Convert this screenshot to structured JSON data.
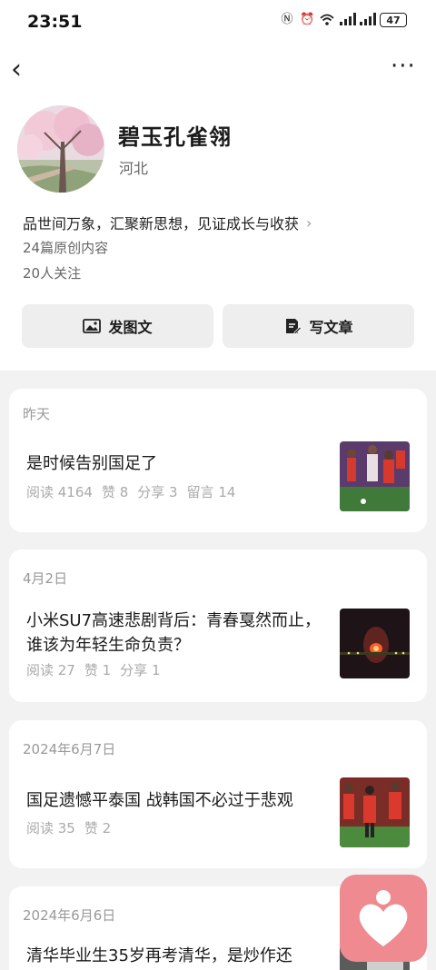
{
  "status": {
    "time": "23:51",
    "battery": "47",
    "icons": [
      "nfc-icon",
      "alarm-icon",
      "wifi-icon",
      "signal-icon",
      "signal-icon"
    ]
  },
  "nav": {
    "back_icon": "back-arrow-icon",
    "more_icon": "more-icon"
  },
  "profile": {
    "name": "碧玉孔雀翎",
    "region": "河北",
    "bio": "品世间万象，汇聚新思想，见证成长与收获",
    "articles": "24篇原创内容",
    "followers": "20人关注"
  },
  "actions": {
    "post_image": "发图文",
    "write_article": "写文章"
  },
  "posts": [
    {
      "date": "昨天",
      "title": "是时候告别国足了",
      "meta": [
        "阅读 4164",
        "赞 8",
        "分享 3",
        "留言 14"
      ]
    },
    {
      "date": "4月2日",
      "title": "小米SU7高速悲剧背后：青春戛然而止，谁该为年轻生命负责？",
      "meta": [
        "阅读 27",
        "赞 1",
        "分享 1"
      ]
    },
    {
      "date": "2024年6月7日",
      "title": "国足遗憾平泰国 战韩国不必过于悲观",
      "meta": [
        "阅读 35",
        "赞 2"
      ]
    },
    {
      "date": "2024年6月6日",
      "title": "清华毕业生35岁再考清华，是炒作还",
      "meta": []
    }
  ],
  "colors": {
    "accent_fab": "#ee8a90",
    "button_bg": "#eeeeee",
    "page_bg": "#f2f2f2"
  }
}
